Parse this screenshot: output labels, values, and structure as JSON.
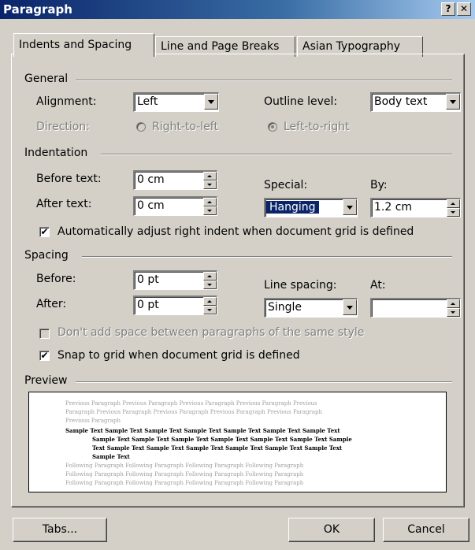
{
  "window": {
    "title": "Paragraph",
    "help_label": "?",
    "close_label": "✕"
  },
  "tabs": [
    {
      "label": "Indents and Spacing",
      "active": true
    },
    {
      "label": "Line and Page Breaks",
      "active": false
    },
    {
      "label": "Asian Typography",
      "active": false
    }
  ],
  "general": {
    "heading": "General",
    "alignment_label": "Alignment:",
    "alignment_value": "Left",
    "outline_label": "Outline level:",
    "outline_value": "Body text",
    "direction_label": "Direction:",
    "rtl_label": "Right-to-left",
    "ltr_label": "Left-to-right"
  },
  "indentation": {
    "heading": "Indentation",
    "before_label": "Before text:",
    "before_value": "0 cm",
    "after_label": "After text:",
    "after_value": "0 cm",
    "special_label": "Special:",
    "special_value": "Hanging",
    "by_label": "By:",
    "by_value": "1.2 cm",
    "auto_adjust_label": "Automatically adjust right indent when document grid is defined",
    "auto_adjust_checked": true
  },
  "spacing": {
    "heading": "Spacing",
    "before_label": "Before:",
    "before_value": "0 pt",
    "after_label": "After:",
    "after_value": "0 pt",
    "line_spacing_label": "Line spacing:",
    "line_spacing_value": "Single",
    "at_label": "At:",
    "at_value": "",
    "dont_add_label": "Don't add space between paragraphs of the same style",
    "dont_add_checked": false,
    "snap_label": "Snap to grid when document grid is defined",
    "snap_checked": true
  },
  "preview": {
    "heading": "Preview",
    "previous_lines": [
      "Previous Paragraph Previous Paragraph Previous Paragraph Previous Paragraph Previous",
      "Paragraph Previous Paragraph Previous Paragraph Previous Paragraph Previous Paragraph",
      "Previous Paragraph"
    ],
    "sample_lines": [
      "Sample Text Sample Text Sample Text Sample Text Sample Text Sample Text Sample Text",
      "Sample Text Sample Text Sample Text Sample Text Sample Text Sample Text Sample",
      "Text Sample Text Sample Text Sample Text Sample Text Sample Text Sample Text",
      "Sample Text"
    ],
    "following_lines": [
      "Following Paragraph Following Paragraph Following Paragraph Following Paragraph",
      "Following Paragraph Following Paragraph Following Paragraph Following Paragraph",
      "Following Paragraph Following Paragraph Following Paragraph Following Paragraph"
    ]
  },
  "buttons": {
    "tabs_label": "Tabs...",
    "ok_label": "OK",
    "cancel_label": "Cancel"
  },
  "icons": {
    "checkbox_mark": "✔"
  }
}
